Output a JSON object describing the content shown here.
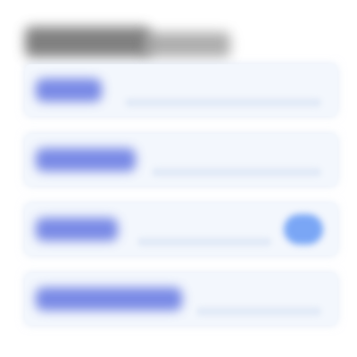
{
  "header": {
    "title": ""
  },
  "rows": [
    {
      "label": "",
      "has_toggle": false
    },
    {
      "label": "",
      "has_toggle": false
    },
    {
      "label": "",
      "has_toggle": true
    },
    {
      "label": "",
      "has_toggle": false
    }
  ],
  "colors": {
    "accent": "#5b6fe0",
    "toggle": "#6d9ef5",
    "row_bg": "#f3f7fd",
    "title": "#6a6a6a"
  }
}
